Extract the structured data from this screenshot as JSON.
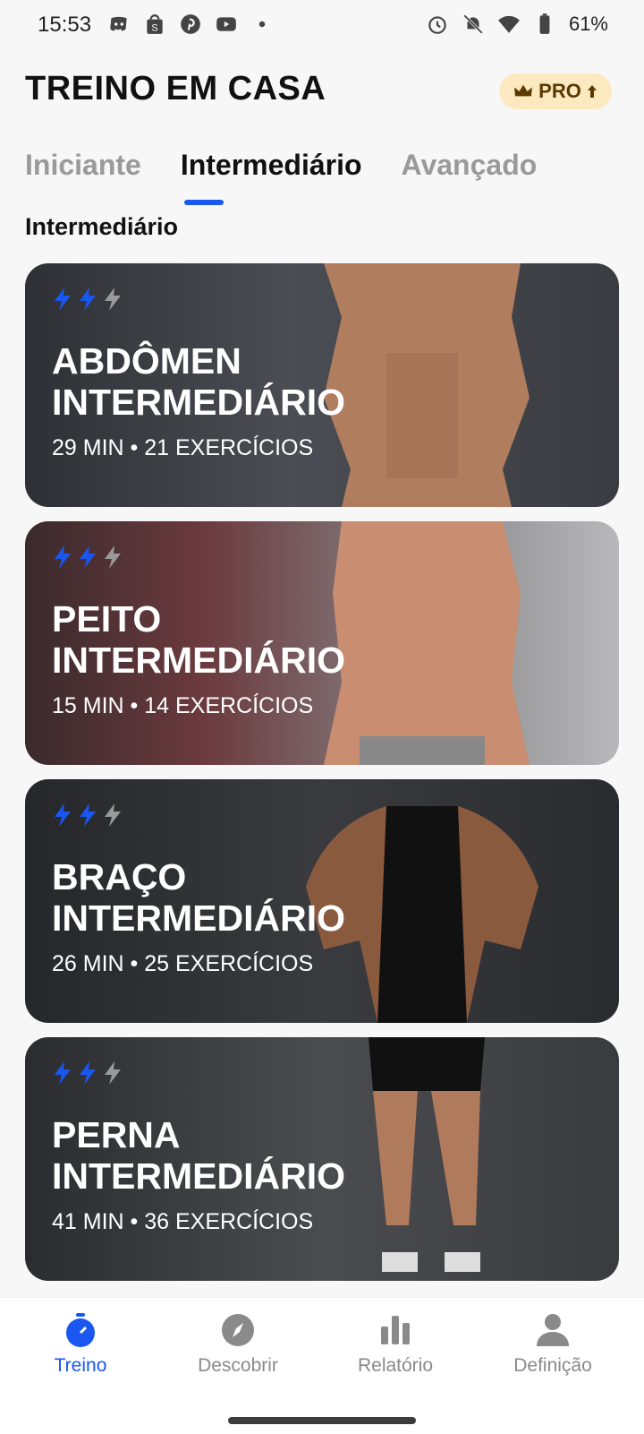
{
  "status_bar": {
    "time": "15:53",
    "notification_icons": [
      "discord-icon",
      "shopping-bag-icon",
      "pinterest-icon",
      "youtube-icon",
      "dot-icon"
    ],
    "right_icons": [
      "alarm-icon",
      "bell-off-icon",
      "wifi-icon",
      "battery-icon"
    ],
    "battery": "61%"
  },
  "header": {
    "title": "TREINO EM CASA",
    "pro_label": "PRO"
  },
  "tabs": [
    {
      "label": "Iniciante",
      "active": false
    },
    {
      "label": "Intermediário",
      "active": true
    },
    {
      "label": "Avançado",
      "active": false
    }
  ],
  "section_title": "Intermediário",
  "workouts": [
    {
      "title_line1": "ABDÔMEN",
      "title_line2": "INTERMEDIÁRIO",
      "meta": "29 MIN • 21 EXERCÍCIOS",
      "level_active": 2,
      "level_total": 3
    },
    {
      "title_line1": "PEITO",
      "title_line2": "INTERMEDIÁRIO",
      "meta": "15 MIN • 14 EXERCÍCIOS",
      "level_active": 2,
      "level_total": 3
    },
    {
      "title_line1": "BRAÇO",
      "title_line2": "INTERMEDIÁRIO",
      "meta": "26 MIN • 25 EXERCÍCIOS",
      "level_active": 2,
      "level_total": 3
    },
    {
      "title_line1": "PERNA",
      "title_line2": "INTERMEDIÁRIO",
      "meta": "41 MIN • 36 EXERCÍCIOS",
      "level_active": 2,
      "level_total": 3
    }
  ],
  "bottom_nav": [
    {
      "label": "Treino",
      "icon": "timer-icon",
      "active": true
    },
    {
      "label": "Descobrir",
      "icon": "compass-icon",
      "active": false
    },
    {
      "label": "Relatório",
      "icon": "bar-chart-icon",
      "active": false
    },
    {
      "label": "Definição",
      "icon": "person-icon",
      "active": false
    }
  ],
  "colors": {
    "accent": "#1a56f0",
    "pro_bg": "#fde9bf",
    "bolt_inactive": "#9a9a9a"
  }
}
